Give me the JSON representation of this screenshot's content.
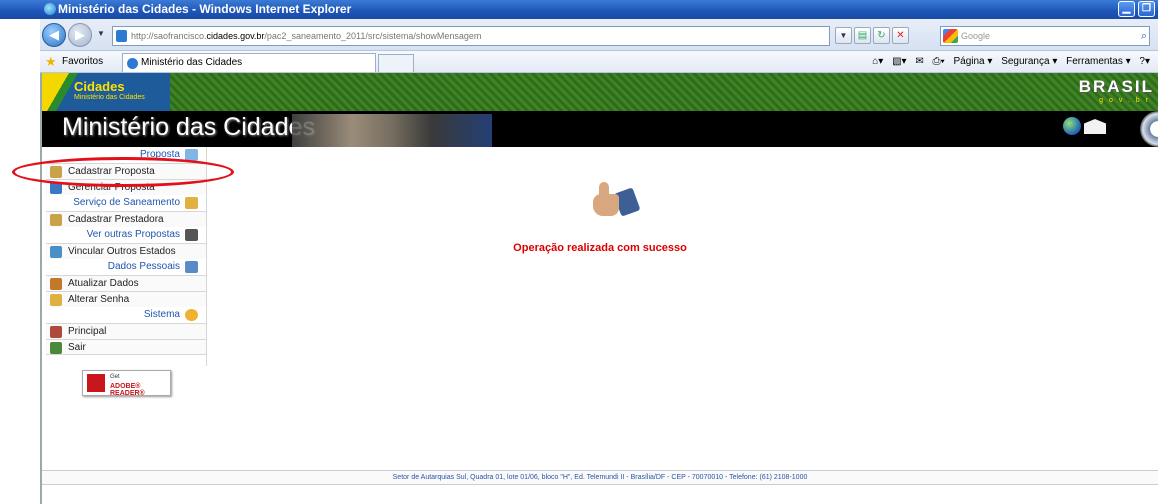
{
  "window": {
    "title": "Ministério das Cidades - Windows Internet Explorer"
  },
  "addressbar": {
    "url_prefix": "http://saofrancisco.",
    "url_host": "cidades.gov.br",
    "url_suffix": "/pac2_saneamento_2011/src/sistema/showMensagem"
  },
  "search": {
    "placeholder": "Google"
  },
  "favorites": {
    "label": "Favoritos",
    "tab_title": "Ministério das Cidades"
  },
  "commandbar": {
    "page": "Página ▾",
    "security": "Segurança ▾",
    "tools": "Ferramentas ▾"
  },
  "banner": {
    "logo_title": "Cidades",
    "logo_subtitle": "Ministério das Cidades",
    "brasil": "BRASIL",
    "brasil_sub": "gov.br",
    "site_title": "Ministério das Cidades"
  },
  "sidebar": {
    "sections": [
      {
        "header": "Proposta",
        "items": [
          "Cadastrar Proposta",
          "Gerenciar Proposta"
        ]
      },
      {
        "header": "Serviço de Saneamento",
        "items": [
          "Cadastrar Prestadora"
        ]
      },
      {
        "header": "Ver outras Propostas",
        "items": [
          "Vincular Outros Estados"
        ]
      },
      {
        "header": "Dados Pessoais",
        "items": [
          "Atualizar Dados",
          "Alterar Senha"
        ]
      },
      {
        "header": "Sistema",
        "items": [
          "Principal",
          "Sair"
        ]
      }
    ]
  },
  "adobe": {
    "get": "Get",
    "reader": "ADOBE® READER®"
  },
  "main": {
    "message": "Operação realizada com sucesso"
  },
  "footer": {
    "text": "Setor de Autarquias Sul, Quadra 01, lote 01/06, bloco \"H\", Ed. Telemundi II - Brasília/DF - CEP - 70070010 - Telefone: (61) 2108-1000"
  },
  "colors": {
    "accent": "#1e56b0",
    "success_message": "#dd0000",
    "annotation": "#e3101a"
  }
}
